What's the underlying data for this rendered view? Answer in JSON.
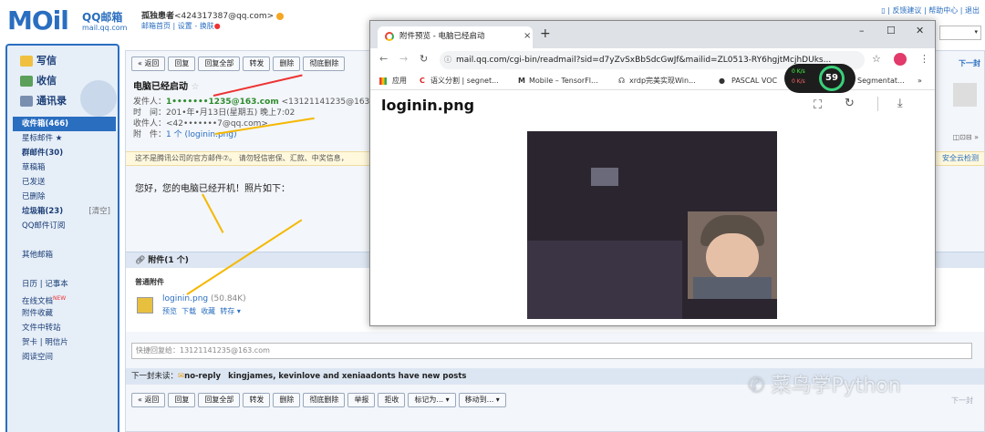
{
  "mail": {
    "logo_word": "MOil",
    "logo_brand": "QQ邮箱",
    "logo_domain": "mail.qq.com",
    "user_name": "孤独患者",
    "user_email": "<424317387@qq.com>",
    "top_links": [
      "邮箱首页",
      "设置",
      "换肤"
    ],
    "right_links": [
      "反馈建议",
      "帮助中心",
      "退出"
    ],
    "sidebar": {
      "write": "写信",
      "inbox": "收信",
      "contacts": "通讯录",
      "folders": [
        {
          "label": "收件箱(466)",
          "selected": true
        },
        {
          "label": "星标邮件 ★"
        },
        {
          "label": "群邮件(30)",
          "bold": true
        },
        {
          "label": "草稿箱"
        },
        {
          "label": "已发送"
        },
        {
          "label": "已删除"
        },
        {
          "label": "垃圾箱(23)",
          "bold": true,
          "extra": "[清空]"
        },
        {
          "label": "QQ邮件订阅"
        },
        {
          "label": ""
        },
        {
          "label": "其他邮箱"
        },
        {
          "label": ""
        },
        {
          "label": "日历 | 记事本"
        },
        {
          "label": "在线文档",
          "badge": "NEW"
        },
        {
          "label": "附件收藏"
        },
        {
          "label": "文件中转站"
        },
        {
          "label": "贺卡 | 明信片"
        },
        {
          "label": "阅读空间"
        }
      ]
    },
    "toolbar": [
      "« 返回",
      "回复",
      "回复全部",
      "转发",
      "删除",
      "彻底删除"
    ],
    "bottom_toolbar": [
      "« 返回",
      "回复",
      "回复全部",
      "转发",
      "删除",
      "彻底删除",
      "举报",
      "拒收",
      "标记为... ▾",
      "移动到... ▾"
    ],
    "subject": "电脑已经启动",
    "from_label": "发件人：",
    "from_value": "1•••••••1235@163.com",
    "from_extra": "<13121141235@163.com>",
    "time_label": "时　间：",
    "time_value": "201•年•月13日(星期五) 晚上7:02",
    "to_label": "收件人：",
    "to_value": "<42•••••••7@qq.com>",
    "attach_label": "附　件：",
    "attach_value": "1 个 (loginin.png)",
    "warning": "这不是腾讯公司的官方邮件⑦。 请勿轻信密保、汇款、中奖信息，",
    "warning_right": "安全云检测",
    "body": "您好，您的电脑已经开机！照片如下：",
    "attachments_title": "附件(1 个)",
    "normal_attach": "普通附件",
    "file_name": "loginin.png",
    "file_size": "(50.84K)",
    "file_actions": [
      "预览",
      "下载",
      "收藏",
      "转存 ▾"
    ],
    "reply_placeholder": "快捷回复给：13121141235@163.com",
    "next_label": "下一封未读：",
    "next_sender": "no-reply",
    "next_subject": "kingjames, kevinlove and xeniaadonts have new posts",
    "next_nav_top": "下一封",
    "next_nav_bottom": "下一封"
  },
  "browser": {
    "tab_title": "附件预览 - 电脑已经启动",
    "tab_close": "×",
    "new_tab": "+",
    "url": "mail.qq.com/cgi-bin/readmail?sid=d7yZvSxBbSdcGwJf&mailid=ZL0513-RY6hgjtMcjhDUks...",
    "bookmarks": [
      "应用",
      "语义分割 | segnet...",
      "Mobile – TensorFl...",
      "xrdp完美实现Win...",
      "PASCAL VOC",
      "Segmentat...",
      "»"
    ],
    "content_title": "loginin.png",
    "window_controls": [
      "–",
      "☐",
      "✕"
    ]
  },
  "overlay": {
    "cpu_percent": "59",
    "net_up": "0 K/s",
    "net_down": "0 K/s"
  },
  "watermark": "菜鸟学Python"
}
